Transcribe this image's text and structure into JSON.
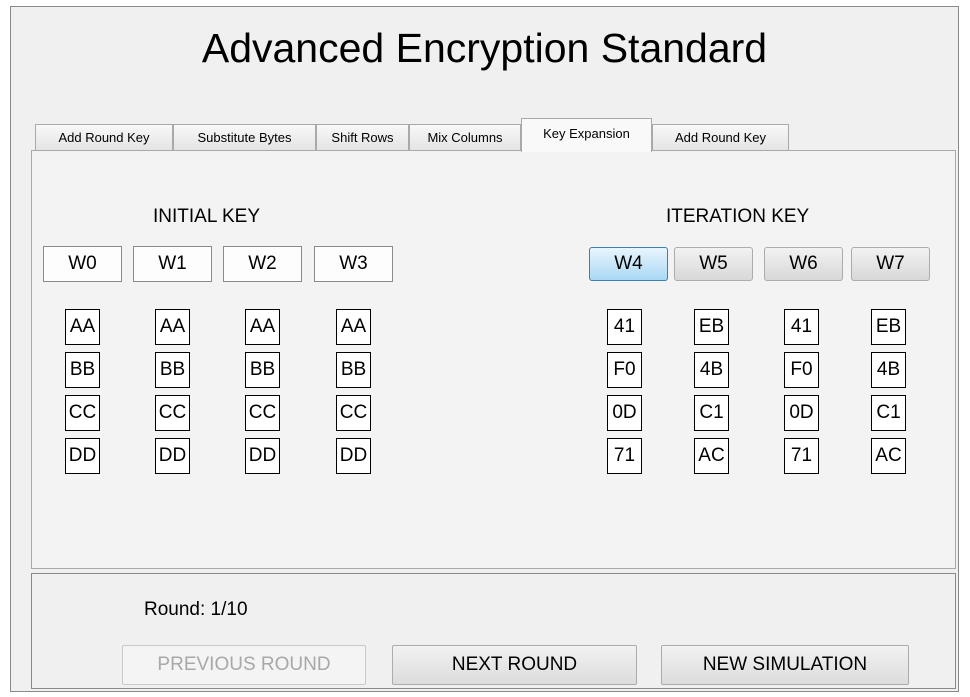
{
  "app": {
    "title": "Advanced Encryption Standard"
  },
  "tabs": [
    {
      "label": "Add Round Key",
      "active": false
    },
    {
      "label": "Substitute Bytes",
      "active": false
    },
    {
      "label": "Shift Rows",
      "active": false
    },
    {
      "label": "Mix Columns",
      "active": false
    },
    {
      "label": "Key Expansion",
      "active": true
    },
    {
      "label": "Add Round Key",
      "active": false
    }
  ],
  "initial_key": {
    "title": "INITIAL KEY",
    "words": [
      {
        "label": "W0",
        "bytes": [
          "AA",
          "BB",
          "CC",
          "DD"
        ]
      },
      {
        "label": "W1",
        "bytes": [
          "AA",
          "BB",
          "CC",
          "DD"
        ]
      },
      {
        "label": "W2",
        "bytes": [
          "AA",
          "BB",
          "CC",
          "DD"
        ]
      },
      {
        "label": "W3",
        "bytes": [
          "AA",
          "BB",
          "CC",
          "DD"
        ]
      }
    ]
  },
  "iteration_key": {
    "title": "ITERATION KEY",
    "selected_word": "W4",
    "words": [
      {
        "label": "W4",
        "bytes": [
          "41",
          "F0",
          "0D",
          "71"
        ]
      },
      {
        "label": "W5",
        "bytes": [
          "EB",
          "4B",
          "C1",
          "AC"
        ]
      },
      {
        "label": "W6",
        "bytes": [
          "41",
          "F0",
          "0D",
          "71"
        ]
      },
      {
        "label": "W7",
        "bytes": [
          "EB",
          "4B",
          "C1",
          "AC"
        ]
      }
    ]
  },
  "footer": {
    "round_text": "Round: 1/10",
    "previous_label": "PREVIOUS ROUND",
    "previous_enabled": false,
    "next_label": "NEXT ROUND",
    "new_label": "NEW SIMULATION"
  }
}
